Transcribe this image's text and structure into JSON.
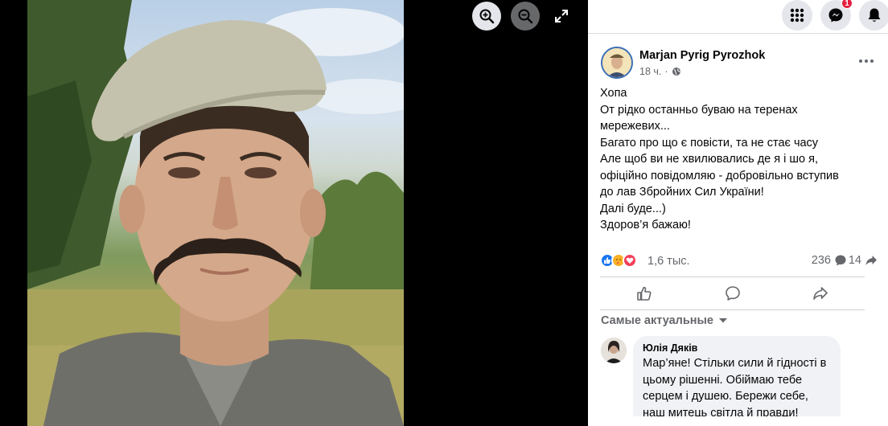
{
  "viewer": {
    "zoom_in_icon": "zoom-in-icon",
    "zoom_out_icon": "zoom-out-icon",
    "fullscreen_icon": "fullscreen-icon"
  },
  "topbar": {
    "menu_icon": "grid-menu-icon",
    "messenger_icon": "messenger-icon",
    "notifications_icon": "bell-icon",
    "notification_count": "1"
  },
  "post": {
    "author": "Marjan Pyrig Pyrozhok",
    "time": "18 ч.",
    "privacy_icon": "globe-icon",
    "lines": [
      "Хопа",
      "От рідко останньо буваю на теренах",
      "мережевих...",
      "Багато про що є повісти, та не стає часу",
      "Але щоб ви не хвилювались де я і шо я,",
      "офіційно повідомляю - добровільно вступив",
      "до лав Збройних Сил України!",
      "Далі буде...)",
      "Здоров’я бажаю!"
    ],
    "reactions_count": "1,6 тыс.",
    "comments_count": "236",
    "shares_count": "14"
  },
  "comments": {
    "sort_label": "Самые актуальные",
    "items": [
      {
        "author": "Юлія Дяків",
        "lines": [
          "Мар’яне! Стільки сили й гідності в",
          "цьому рішенні. Обіймаю тебе",
          "серцем і душею. Бережи себе,",
          "наш митець світла й правди!"
        ]
      }
    ]
  },
  "colors": {
    "accent": "#1877f2",
    "like": "#1877f2",
    "love": "#f33e58",
    "care": "#f7b125",
    "badge": "#e41e3f"
  }
}
